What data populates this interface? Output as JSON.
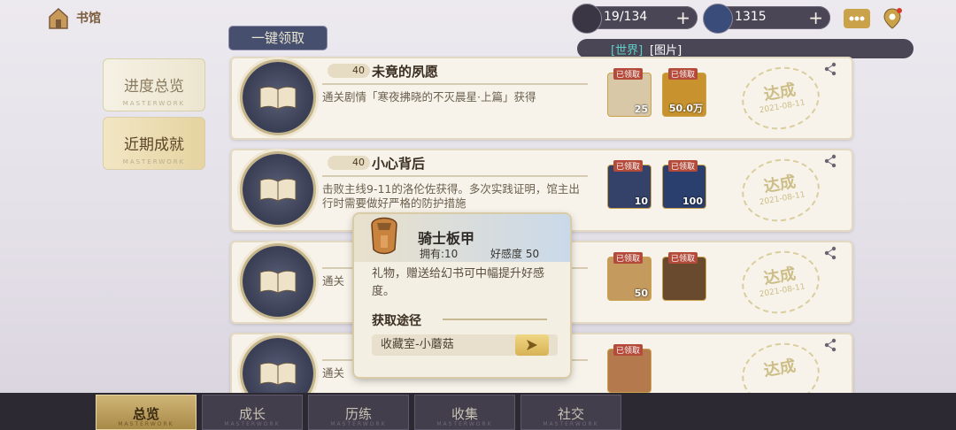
{
  "header": {
    "home_label": "书馆",
    "stamina": "19/134",
    "crystals": "1315",
    "claim_all": "一键领取",
    "world_tag": "[世界]",
    "world_msg": "[图片]"
  },
  "left_tabs": [
    {
      "label": "进度总览",
      "mark": "MASTERWORK",
      "active": false
    },
    {
      "label": "近期成就",
      "mark": "MASTERWORK",
      "active": true
    }
  ],
  "cards": [
    {
      "points": "40",
      "title": "未竟的夙愿",
      "desc": "通关剧情「寒夜拂晓的不灭晨星·上篇」获得",
      "rewards": [
        {
          "badge": "已领取",
          "count": "25",
          "icon": "character-card-icon",
          "color": "#d8c8a8"
        },
        {
          "badge": "已领取",
          "count": "50.0万",
          "icon": "gold-coin-icon",
          "color": "#c8922e"
        }
      ],
      "stamp": "达成",
      "date": "2021-08-11"
    },
    {
      "points": "40",
      "title": "小心背后",
      "desc": "击败主线9-11的洛伦佐获得。多次实践证明，馆主出行时需要做好严格的防护措施",
      "rewards": [
        {
          "badge": "已领取",
          "count": "10",
          "icon": "knight-armor-icon",
          "color": "#34426a"
        },
        {
          "badge": "已领取",
          "count": "100",
          "icon": "crystal-pile-icon",
          "color": "#2a3f6e"
        }
      ],
      "stamp": "达成",
      "date": "2021-08-11"
    },
    {
      "points": "",
      "title": "",
      "desc": "通关",
      "rewards": [
        {
          "badge": "已领取",
          "count": "50",
          "icon": "feather-crystal-icon",
          "color": "#c49a5e"
        },
        {
          "badge": "已领取",
          "count": "",
          "icon": "dark-ring-icon",
          "color": "#6a4a2e"
        }
      ],
      "stamp": "达成",
      "date": "2021-08-11"
    },
    {
      "points": "",
      "title": "",
      "desc": "通关",
      "rewards": [
        {
          "badge": "已领取",
          "count": "",
          "icon": "crystal-icon",
          "color": "#b47a4e"
        }
      ],
      "stamp": "达成",
      "date": ""
    }
  ],
  "tooltip": {
    "name": "骑士板甲",
    "owned": "拥有:10",
    "favor": "好感度 50",
    "desc": "礼物，赠送给幻书可中幅提升好感度。",
    "source_title": "获取途径",
    "source_item": "收藏室-小蘑菇"
  },
  "bottom_tabs": [
    {
      "label": "总览",
      "mark": "MASTERWORK",
      "active": true
    },
    {
      "label": "成长",
      "mark": "MASTERWORK",
      "active": false
    },
    {
      "label": "历练",
      "mark": "MASTERWORK",
      "active": false
    },
    {
      "label": "收集",
      "mark": "MASTERWORK",
      "active": false
    },
    {
      "label": "社交",
      "mark": "MASTERWORK",
      "active": false
    }
  ]
}
